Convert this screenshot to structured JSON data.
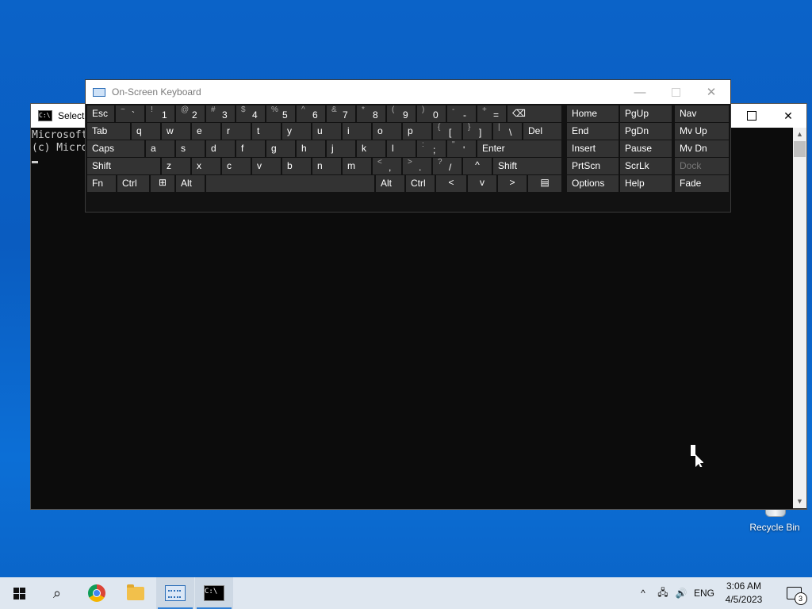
{
  "desktop": {
    "recycle_bin_label": "Recycle Bin"
  },
  "cmd": {
    "title": "Select A",
    "icon_text": "C:\\",
    "lines": [
      "Microsoft",
      "(c) Micro"
    ]
  },
  "osk": {
    "title": "On-Screen Keyboard",
    "minimize": "—",
    "close": "✕",
    "keys": {
      "esc": "Esc",
      "tilde": [
        "~",
        "`"
      ],
      "k1": [
        "!",
        "1"
      ],
      "k2": [
        "@",
        "2"
      ],
      "k3": [
        "#",
        "3"
      ],
      "k4": [
        "$",
        "4"
      ],
      "k5": [
        "%",
        "5"
      ],
      "k6": [
        "^",
        "6"
      ],
      "k7": [
        "&",
        "7"
      ],
      "k8": [
        "*",
        "8"
      ],
      "k9": [
        "(",
        "9"
      ],
      "k0": [
        ")",
        "0"
      ],
      "minus": [
        "-",
        "-"
      ],
      "equal": [
        "+",
        "="
      ],
      "backspace": "⌫",
      "tab": "Tab",
      "q": "q",
      "w": "w",
      "e": "e",
      "r": "r",
      "t": "t",
      "y": "y",
      "u": "u",
      "i": "i",
      "o": "o",
      "p": "p",
      "lbracket": [
        "{",
        "["
      ],
      "rbracket": [
        "}",
        "]"
      ],
      "backslash": [
        "|",
        "\\"
      ],
      "del": "Del",
      "caps": "Caps",
      "a": "a",
      "s": "s",
      "d": "d",
      "f": "f",
      "g": "g",
      "h": "h",
      "j": "j",
      "k": "k",
      "l": "l",
      "semicolon": [
        ":",
        ";"
      ],
      "quote": [
        "\"",
        "'"
      ],
      "enter": "Enter",
      "lshift": "Shift",
      "z": "z",
      "x": "x",
      "c": "c",
      "v": "v",
      "b": "b",
      "n": "n",
      "m": "m",
      "comma": [
        "<",
        ","
      ],
      "period": [
        ">",
        "."
      ],
      "slash": [
        "?",
        "/"
      ],
      "up": "^",
      "rshift": "Shift",
      "fn": "Fn",
      "lctrl": "Ctrl",
      "winkey": "⊞",
      "lalt": "Alt",
      "space": "",
      "ralt": "Alt",
      "rctrl": "Ctrl",
      "left": "<",
      "down": "v",
      "right": ">",
      "menu": "▤",
      "home": "Home",
      "pgup": "PgUp",
      "nav": "Nav",
      "end": "End",
      "pgdn": "PgDn",
      "mvup": "Mv Up",
      "insert": "Insert",
      "pause": "Pause",
      "mvdn": "Mv Dn",
      "prtscn": "PrtScn",
      "scrlk": "ScrLk",
      "dock": "Dock",
      "options": "Options",
      "help": "Help",
      "fade": "Fade"
    }
  },
  "taskbar": {
    "search_glyph": "⌕",
    "tray": {
      "chevron": "^",
      "network": "🖧",
      "volume": "🔊",
      "language": "ENG"
    },
    "time": "3:06 AM",
    "date": "4/5/2023",
    "notifications_count": "3"
  }
}
